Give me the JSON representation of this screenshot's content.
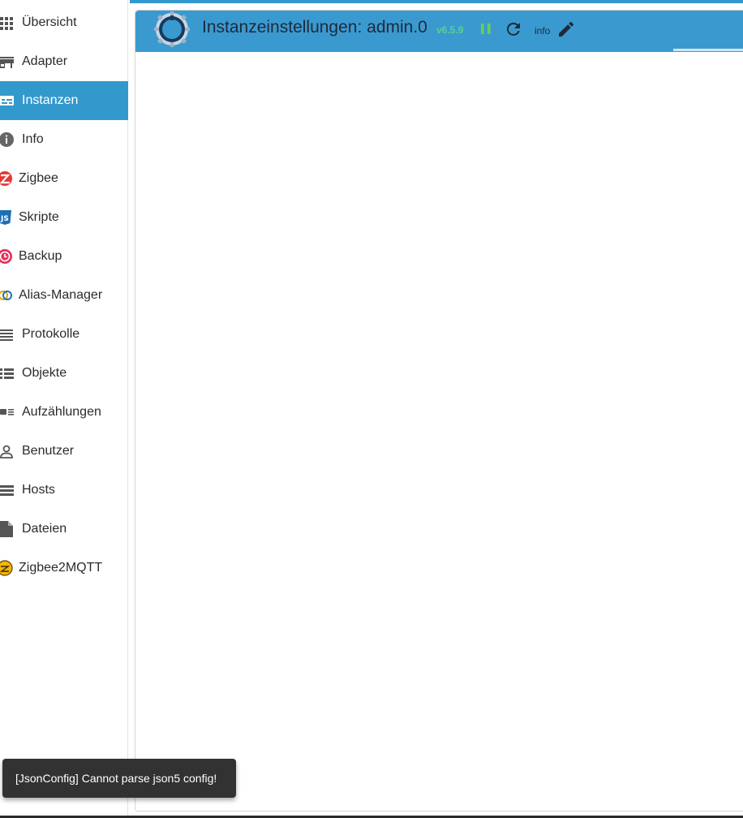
{
  "sidebar": {
    "items": [
      {
        "label": "Übersicht",
        "icon": "grid-icon",
        "active": false
      },
      {
        "label": "Adapter",
        "icon": "store-icon",
        "active": false
      },
      {
        "label": "Instanzen",
        "icon": "instances-icon",
        "active": true
      },
      {
        "label": "Info",
        "icon": "info-icon",
        "active": false
      },
      {
        "label": "Zigbee",
        "icon": "zigbee-icon",
        "active": false
      },
      {
        "label": "Skripte",
        "icon": "javascript-icon",
        "active": false
      },
      {
        "label": "Backup",
        "icon": "backup-clock-icon",
        "active": false
      },
      {
        "label": "Alias-Manager",
        "icon": "alias-icon",
        "active": false
      },
      {
        "label": "Protokolle",
        "icon": "log-lines-icon",
        "active": false
      },
      {
        "label": "Objekte",
        "icon": "list-icon",
        "active": false
      },
      {
        "label": "Aufzählungen",
        "icon": "enum-list-icon",
        "active": false
      },
      {
        "label": "Benutzer",
        "icon": "user-icon",
        "active": false
      },
      {
        "label": "Hosts",
        "icon": "hosts-icon",
        "active": false
      },
      {
        "label": "Dateien",
        "icon": "file-icon",
        "active": false
      },
      {
        "label": "Zigbee2MQTT",
        "icon": "zigbee2mqtt-icon",
        "active": false
      }
    ]
  },
  "header": {
    "title": "Instanzeinstellungen: admin.0",
    "version": "v6.5.9",
    "info_label": "info",
    "logo_icon": "admin-gear-logo-icon",
    "pause_icon": "pause-icon",
    "reload_icon": "reload-icon",
    "edit_icon": "pencil-icon"
  },
  "snackbar": {
    "message": "[JsonConfig] Cannot parse json5 config!"
  },
  "colors": {
    "accent": "#3399cc",
    "header": "#3a9ad0",
    "version_green": "#56d38a",
    "snackbar_bg": "#323232"
  }
}
